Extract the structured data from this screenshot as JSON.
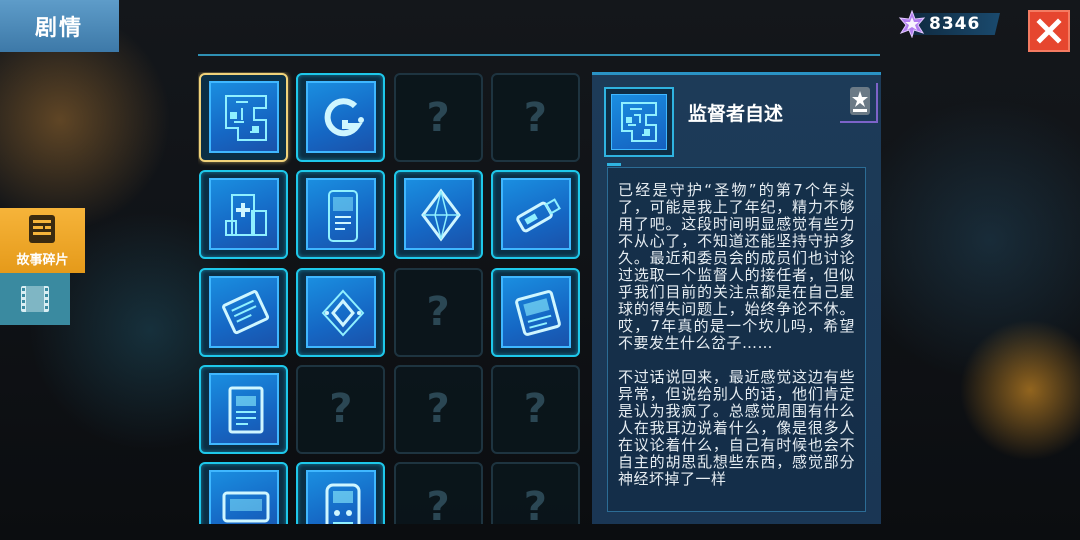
{
  "header": {
    "title": "剧情"
  },
  "currency": {
    "icon": "purple-star-gem-icon",
    "amount": "8346"
  },
  "close": {
    "icon": "close-icon"
  },
  "side_tabs": [
    {
      "label": "故事碎片",
      "icon": "story-fragment-icon",
      "active": true
    },
    {
      "label": "",
      "icon": "film-strip-icon",
      "active": false
    }
  ],
  "grid": {
    "slots": [
      {
        "state": "filled",
        "icon": "circuit-board-icon",
        "selected": true
      },
      {
        "state": "filled",
        "icon": "g-logo-icon"
      },
      {
        "state": "empty",
        "label": "?"
      },
      {
        "state": "empty",
        "label": "?"
      },
      {
        "state": "filled",
        "icon": "medical-device-icon"
      },
      {
        "state": "filled",
        "icon": "terminal-device-icon"
      },
      {
        "state": "filled",
        "icon": "crystal-icon"
      },
      {
        "state": "filled",
        "icon": "usb-drive-icon"
      },
      {
        "state": "filled",
        "icon": "book-icon"
      },
      {
        "state": "filled",
        "icon": "data-core-icon"
      },
      {
        "state": "empty",
        "label": "?"
      },
      {
        "state": "filled",
        "icon": "notebook-icon"
      },
      {
        "state": "filled",
        "icon": "manual-icon"
      },
      {
        "state": "empty",
        "label": "?"
      },
      {
        "state": "empty",
        "label": "?"
      },
      {
        "state": "empty",
        "label": "?"
      },
      {
        "state": "filled",
        "icon": "console-icon"
      },
      {
        "state": "filled",
        "icon": "robot-device-icon"
      },
      {
        "state": "empty",
        "label": "?"
      },
      {
        "state": "empty",
        "label": "?"
      }
    ]
  },
  "detail": {
    "title": "监督者自述",
    "icon": "circuit-board-icon",
    "badge_icon": "star-badge-icon",
    "paragraphs": [
      "已经是守护“圣物”的第7个年头了，可能是我上了年纪，精力不够用了吧。这段时间明显感觉有些力不从心了，不知道还能坚持守护多久。最近和委员会的成员们也讨论过选取一个监督人的接任者，但似乎我们目前的关注点都是在自己星球的得失问题上，始终争论不休。哎，7年真的是一个坎儿吗，希望不要发生什么岔子……",
      "不过话说回来，最近感觉这边有些异常，但说给别人的话，他们肯定是认为我疯了。总感觉周围有什么人在我耳边说着什么，像是很多人在议论着什么，自己有时候也会不自主的胡思乱想些东西，感觉部分神经坏掉了一样"
    ]
  }
}
